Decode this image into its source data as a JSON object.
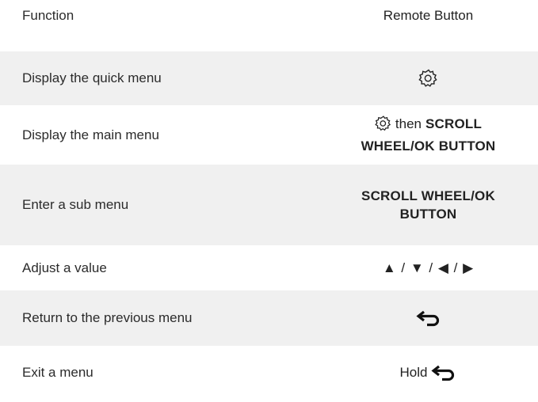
{
  "header": {
    "function_label": "Function",
    "button_label": "Remote Button"
  },
  "rows": [
    {
      "function": "Display the quick menu",
      "icon": "gear-icon"
    },
    {
      "function": "Display the main menu",
      "icon": "gear-icon",
      "then_text": "then",
      "button_line1": "SCROLL",
      "button_line2": "WHEEL/OK BUTTON"
    },
    {
      "function": "Enter a sub menu",
      "button_line1": "SCROLL WHEEL/OK",
      "button_line2": "BUTTON"
    },
    {
      "function": "Adjust a value",
      "arrows": "▲ / ▼ / ◀ / ▶"
    },
    {
      "function": "Return to the previous menu",
      "icon": "back-arrow-icon"
    },
    {
      "function": "Exit a menu",
      "hold_text": "Hold",
      "icon": "back-arrow-icon"
    }
  ],
  "colors": {
    "shaded_row": "#f0f0f0",
    "text": "#222222"
  }
}
